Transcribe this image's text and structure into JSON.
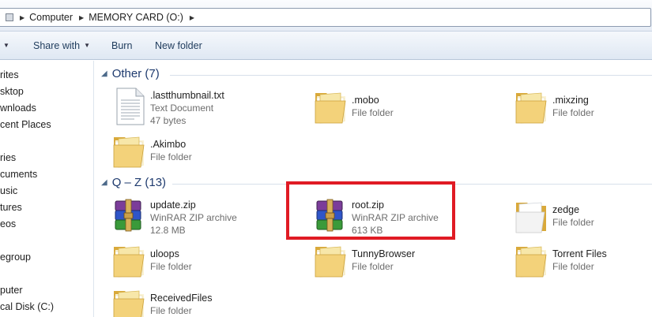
{
  "address_bar": {
    "crumbs": [
      "Computer",
      "MEMORY CARD (O:)"
    ]
  },
  "toolbar": {
    "share_with": "Share with",
    "burn": "Burn",
    "new_folder": "New folder"
  },
  "nav": {
    "items": [
      "rites",
      "sktop",
      "wnloads",
      "cent Places",
      "ries",
      "cuments",
      "usic",
      "tures",
      "eos",
      "egroup",
      "puter",
      "cal Disk (C:)"
    ]
  },
  "groups": {
    "other": {
      "title": "Other (7)",
      "items": [
        {
          "name": ".lastthumbnail.txt",
          "type": "Text Document",
          "size": "47 bytes",
          "icon": "text-document-icon"
        },
        {
          "name": ".mobo",
          "type": "File folder",
          "icon": "folder-icon"
        },
        {
          "name": ".mixzing",
          "type": "File folder",
          "icon": "folder-icon"
        },
        {
          "name": ".Akimbo",
          "type": "File folder",
          "icon": "folder-icon"
        }
      ]
    },
    "q_z": {
      "title": "Q – Z (13)",
      "items": [
        {
          "name": "update.zip",
          "type": "WinRAR ZIP archive",
          "size": "12.8 MB",
          "icon": "winrar-archive-icon"
        },
        {
          "name": "root.zip",
          "type": "WinRAR ZIP archive",
          "size": "613 KB",
          "icon": "winrar-archive-icon"
        },
        {
          "name": "zedge",
          "type": "File folder",
          "icon": "folder-icon"
        },
        {
          "name": "uloops",
          "type": "File folder",
          "icon": "folder-icon"
        },
        {
          "name": "TunnyBrowser",
          "type": "File folder",
          "icon": "folder-icon"
        },
        {
          "name": "Torrent Files",
          "type": "File folder",
          "icon": "folder-icon"
        },
        {
          "name": "ReceivedFiles",
          "type": "File folder",
          "icon": "folder-icon"
        }
      ]
    }
  },
  "colors": {
    "highlight": "#e01b24",
    "group_title": "#1e3a6e",
    "folder": "#f3d27a"
  }
}
